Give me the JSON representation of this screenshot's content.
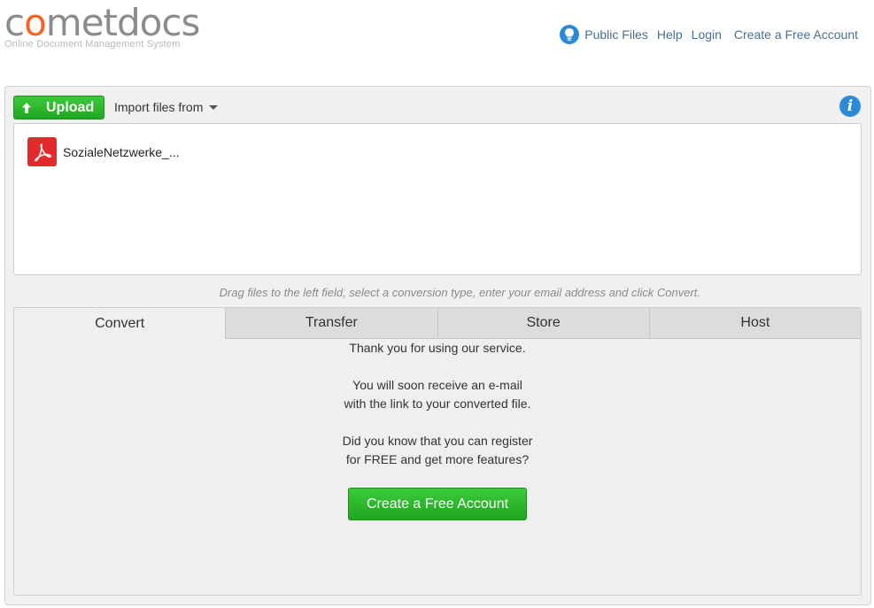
{
  "logo": {
    "word_pre": "c",
    "word_o": "o",
    "word_post": "metdocs",
    "tagline": "Online Document Management System"
  },
  "topnav": {
    "icon": "lightbulb-icon",
    "items": [
      "Public Files",
      "Help",
      "Login",
      "Create a Free Account"
    ]
  },
  "toolbar": {
    "upload_label": "Upload",
    "import_label": "Import files from",
    "info_glyph": "i"
  },
  "files": [
    {
      "name": "SozialeNetzwerke_...",
      "type": "pdf"
    }
  ],
  "hint": "Drag files to the left field, select a conversion type, enter your email address and click Convert.",
  "tabs": [
    "Convert",
    "Transfer",
    "Store",
    "Host"
  ],
  "active_tab": "Convert",
  "message": {
    "line1": "Thank you for using our service.",
    "line2": "You will soon receive an e-mail",
    "line3": "with the link to your converted file.",
    "line4": "Did you know that you can register",
    "line5": "for FREE and get more features?",
    "cta": "Create a Free Account"
  },
  "colors": {
    "accent_green": "#21a821",
    "link_blue": "#4a6f8f",
    "info_blue": "#2b8ad6",
    "logo_orange": "#f26522",
    "pdf_red": "#e32b2b"
  }
}
